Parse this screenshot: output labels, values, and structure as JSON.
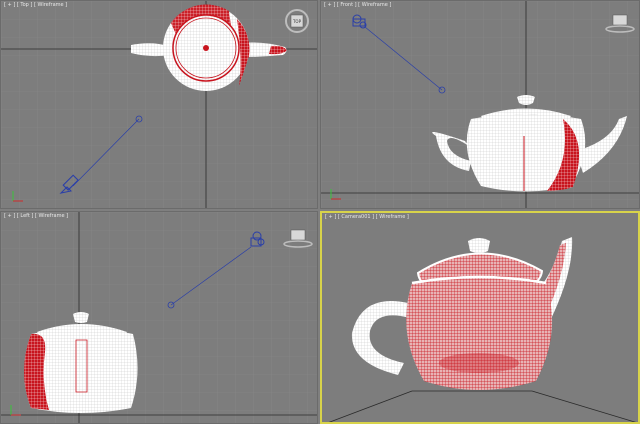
{
  "viewports": {
    "top": {
      "label": "[ + ] [ Top ] [ Wireframe ]"
    },
    "front": {
      "label": "[ + ] [ Front ] [ Wireframe ]"
    },
    "left": {
      "label": "[ + ] [ Left ] [ Wireframe ]"
    },
    "camera": {
      "label": "[ + ] [ Camera001 ] [ Wireframe ]"
    }
  },
  "colors": {
    "background": "#7d7d7d",
    "grid": "#8a8a8a",
    "axis": "#2a2a2a",
    "mesh_white": "#ffffff",
    "mesh_red": "#c8141e",
    "camera_blue": "#2a3fa8",
    "active_border": "#d8d34a"
  },
  "icons": [
    "viewcube-icon",
    "camera-icon",
    "camera-target-icon",
    "axis-tripod-icon",
    "teapot-mesh"
  ]
}
